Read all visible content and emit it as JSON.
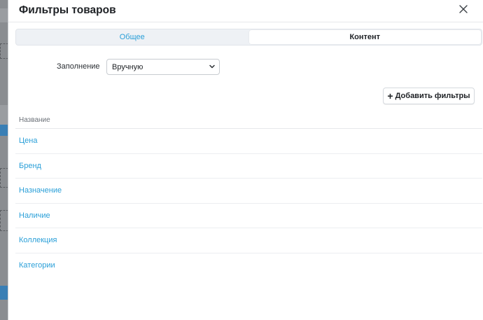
{
  "modal": {
    "title": "Фильтры товаров"
  },
  "tabs": [
    {
      "label": "Общее"
    },
    {
      "label": "Контент"
    }
  ],
  "fill": {
    "label": "Заполнение",
    "value": "Вручную"
  },
  "add_button": {
    "label": "Добавить фильтры"
  },
  "table": {
    "header": "Название",
    "rows": [
      {
        "name": "Цена"
      },
      {
        "name": "Бренд"
      },
      {
        "name": "Назначение"
      },
      {
        "name": "Наличие"
      },
      {
        "name": "Коллекция"
      },
      {
        "name": "Категории"
      }
    ]
  },
  "colors": {
    "accent": "#2a9fd8",
    "text": "#1e2125"
  }
}
